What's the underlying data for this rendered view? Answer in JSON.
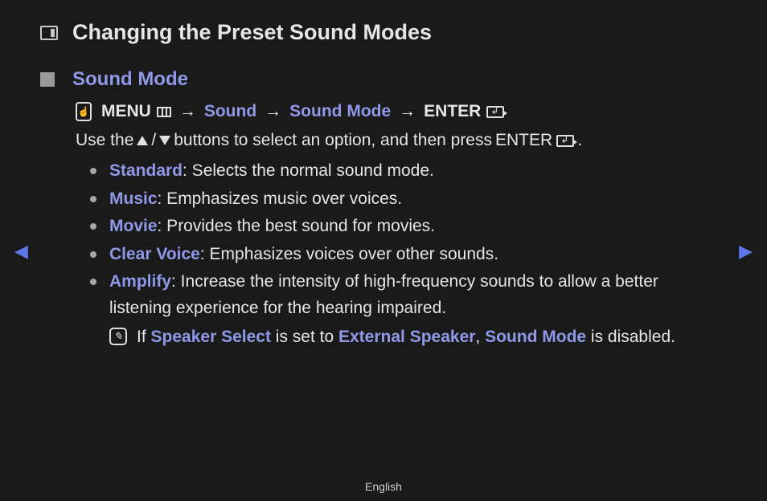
{
  "title": "Changing the Preset Sound Modes",
  "section_title": "Sound Mode",
  "nav": {
    "menu": "MENU",
    "step1": "Sound",
    "step2": "Sound Mode",
    "enter": "ENTER"
  },
  "instruction": {
    "pre": "Use the ",
    "mid": " buttons to select an option, and then press ",
    "enter": "ENTER",
    "post": "."
  },
  "options": [
    {
      "name": "Standard",
      "desc": ": Selects the normal sound mode."
    },
    {
      "name": "Music",
      "desc": ": Emphasizes music over voices."
    },
    {
      "name": "Movie",
      "desc": ": Provides the best sound for movies."
    },
    {
      "name": "Clear Voice",
      "desc": ": Emphasizes voices over other sounds."
    },
    {
      "name": "Amplify",
      "desc": ": Increase the intensity of high-frequency sounds to allow a better listening experience for the hearing impaired."
    }
  ],
  "note": {
    "pre": "If ",
    "speaker_select": "Speaker Select",
    "mid1": " is set to ",
    "external_speaker": "External Speaker",
    "mid2": ", ",
    "sound_mode": "Sound Mode",
    "post": " is disabled."
  },
  "footer_lang": "English"
}
